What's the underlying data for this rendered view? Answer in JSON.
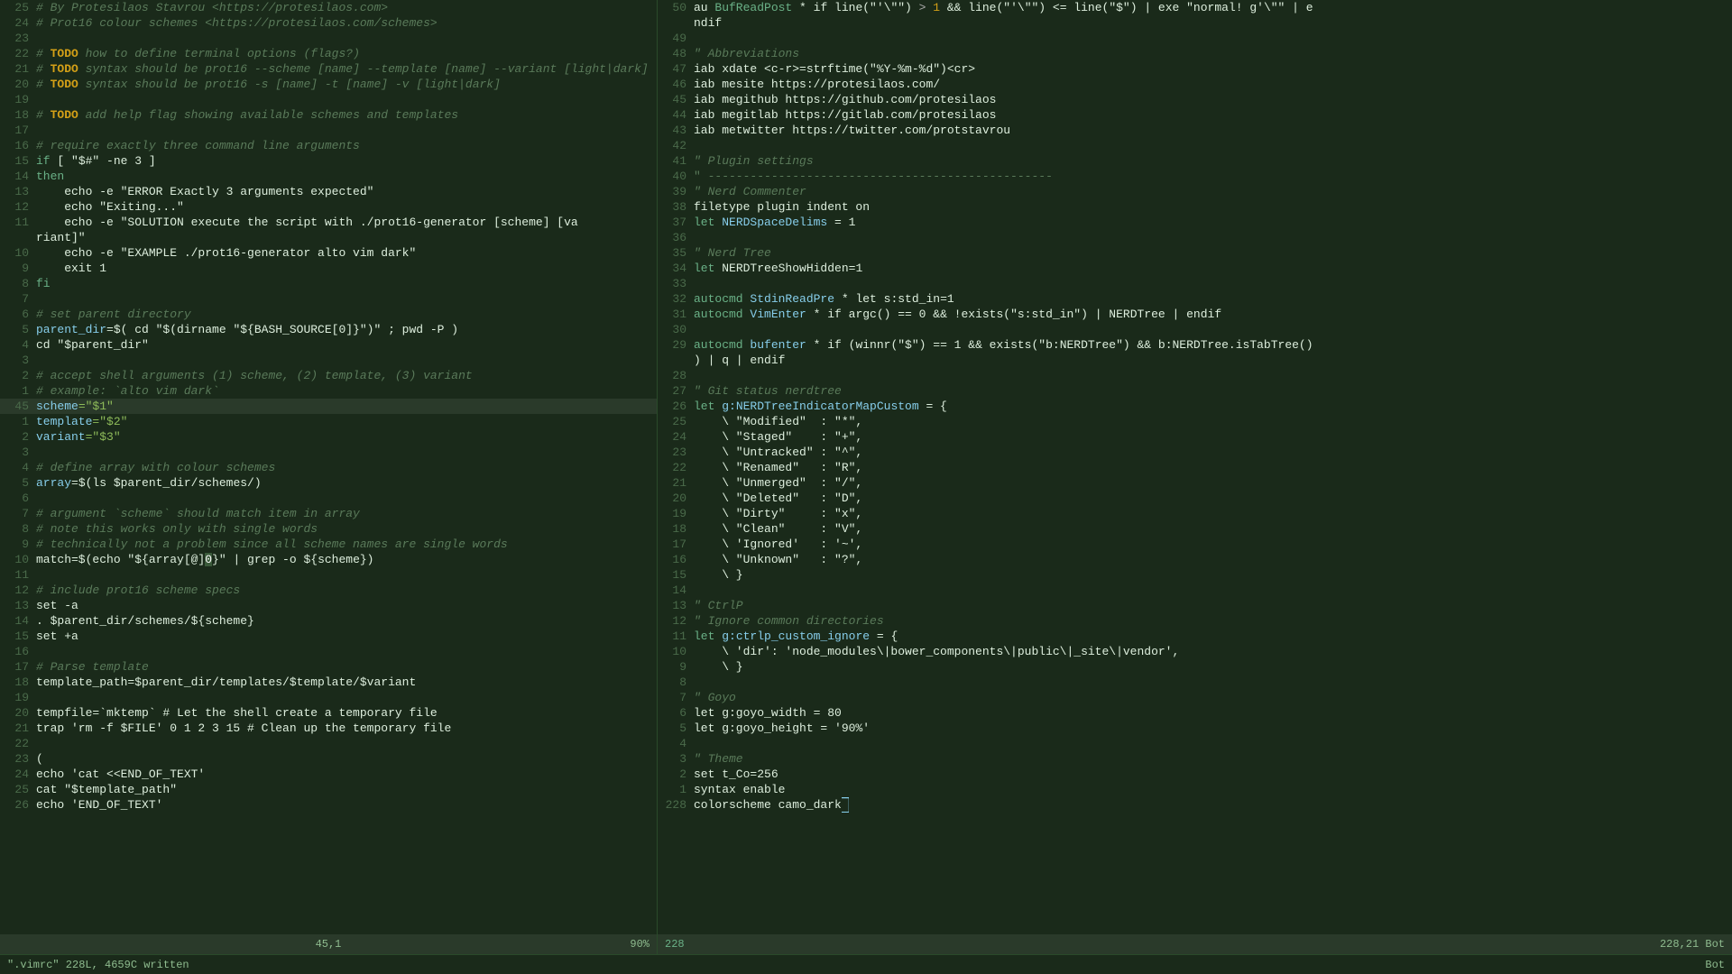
{
  "left_pane": {
    "lines": [
      {
        "num": "25",
        "content": [
          {
            "t": "# By Protesilaos Stavrou <https://protesilaos.com>",
            "c": "c-comment"
          }
        ]
      },
      {
        "num": "24",
        "content": [
          {
            "t": "# Prot16 colour schemes <https://protesilaos.com/schemes>",
            "c": "c-comment"
          }
        ]
      },
      {
        "num": "23",
        "content": []
      },
      {
        "num": "22",
        "content": [
          {
            "t": "# ",
            "c": "c-comment"
          },
          {
            "t": "TODO",
            "c": "c-todo"
          },
          {
            "t": " how to define terminal options (flags?)",
            "c": "c-comment"
          }
        ]
      },
      {
        "num": "21",
        "content": [
          {
            "t": "# ",
            "c": "c-comment"
          },
          {
            "t": "TODO",
            "c": "c-todo"
          },
          {
            "t": " syntax should be prot16 --scheme [name] --template [name] --variant [light|dark]",
            "c": "c-comment"
          }
        ]
      },
      {
        "num": "20",
        "content": [
          {
            "t": "# ",
            "c": "c-comment"
          },
          {
            "t": "TODO",
            "c": "c-todo"
          },
          {
            "t": " syntax should be prot16 -s [name] -t [name] -v [light|dark]",
            "c": "c-comment"
          }
        ]
      },
      {
        "num": "19",
        "content": []
      },
      {
        "num": "18",
        "content": [
          {
            "t": "# ",
            "c": "c-comment"
          },
          {
            "t": "TODO",
            "c": "c-todo"
          },
          {
            "t": " add help flag showing available schemes and templates",
            "c": "c-comment"
          }
        ]
      },
      {
        "num": "17",
        "content": []
      },
      {
        "num": "16",
        "content": [
          {
            "t": "# require exactly three command line arguments",
            "c": "c-comment"
          }
        ]
      },
      {
        "num": "15",
        "content": [
          {
            "t": "if",
            "c": "c-keyword"
          },
          {
            "t": " [ \"$#\" -ne 3 ]",
            "c": "c-white"
          }
        ]
      },
      {
        "num": "14",
        "content": [
          {
            "t": "then",
            "c": "c-keyword"
          }
        ]
      },
      {
        "num": "13",
        "content": [
          {
            "t": "    echo -e \"ERROR Exactly 3 arguments expected\"",
            "c": "c-white"
          }
        ]
      },
      {
        "num": "12",
        "content": [
          {
            "t": "    echo \"Exiting...\"",
            "c": "c-white"
          }
        ]
      },
      {
        "num": "11",
        "content": [
          {
            "t": "    echo -e \"SOLUTION execute the script with ./prot16-generator [scheme] [va",
            "c": "c-white"
          }
        ]
      },
      {
        "num": "",
        "content": [
          {
            "t": "riant]\"",
            "c": "c-white"
          }
        ]
      },
      {
        "num": "10",
        "content": [
          {
            "t": "    echo -e \"EXAMPLE ./prot16-generator alto vim dark\"",
            "c": "c-white"
          }
        ]
      },
      {
        "num": "9",
        "content": [
          {
            "t": "    exit 1",
            "c": "c-white"
          }
        ]
      },
      {
        "num": "8",
        "content": [
          {
            "t": "fi",
            "c": "c-keyword"
          }
        ]
      },
      {
        "num": "7",
        "content": []
      },
      {
        "num": "6",
        "content": [
          {
            "t": "# set parent directory",
            "c": "c-comment"
          }
        ]
      },
      {
        "num": "5",
        "content": [
          {
            "t": "parent_dir",
            "c": "c-var"
          },
          {
            "t": "=$( cd \"$(dirname \"${BASH_SOURCE[0]}\")\" ; pwd -P )",
            "c": "c-white"
          }
        ]
      },
      {
        "num": "4",
        "content": [
          {
            "t": "cd \"$parent_dir\"",
            "c": "c-white"
          }
        ]
      },
      {
        "num": "3",
        "content": []
      },
      {
        "num": "2",
        "content": [
          {
            "t": "# accept shell arguments (1) scheme, (2) template, (3) variant",
            "c": "c-comment"
          }
        ]
      },
      {
        "num": "1",
        "content": [
          {
            "t": "# example: `alto vim dark`",
            "c": "c-comment"
          }
        ]
      },
      {
        "num": "45",
        "highlight": true,
        "content": [
          {
            "t": "scheme",
            "c": "c-var"
          },
          {
            "t": "=\"$1\"",
            "c": "c-string"
          }
        ]
      },
      {
        "num": "1",
        "content": [
          {
            "t": "template",
            "c": "c-var"
          },
          {
            "t": "=\"$2\"",
            "c": "c-string"
          }
        ]
      },
      {
        "num": "2",
        "content": [
          {
            "t": "variant",
            "c": "c-var"
          },
          {
            "t": "=\"$3\"",
            "c": "c-string"
          }
        ]
      },
      {
        "num": "3",
        "content": []
      },
      {
        "num": "4",
        "content": [
          {
            "t": "# define array with colour schemes",
            "c": "c-comment"
          }
        ]
      },
      {
        "num": "5",
        "content": [
          {
            "t": "array",
            "c": "c-var"
          },
          {
            "t": "=$(ls $parent_dir/schemes/)",
            "c": "c-white"
          }
        ]
      },
      {
        "num": "6",
        "content": []
      },
      {
        "num": "7",
        "content": [
          {
            "t": "# argument `scheme` should match item in array",
            "c": "c-comment"
          }
        ]
      },
      {
        "num": "8",
        "content": [
          {
            "t": "# note this works only with single words",
            "c": "c-comment"
          }
        ]
      },
      {
        "num": "9",
        "content": [
          {
            "t": "# technically not a problem since all scheme names are single words",
            "c": "c-comment"
          }
        ]
      },
      {
        "num": "10",
        "content": [
          {
            "t": "match=$(echo \"${array[@]",
            "c": "c-white"
          },
          {
            "t": "0",
            "c": "c-highlight"
          },
          {
            "t": "}\" | grep -o ${scheme})",
            "c": "c-white"
          }
        ]
      },
      {
        "num": "11",
        "content": []
      },
      {
        "num": "12",
        "content": [
          {
            "t": "# include prot16 scheme specs",
            "c": "c-comment"
          }
        ]
      },
      {
        "num": "13",
        "content": [
          {
            "t": "set -a",
            "c": "c-white"
          }
        ]
      },
      {
        "num": "14",
        "content": [
          {
            "t": ". $parent_dir/schemes/${scheme}",
            "c": "c-white"
          }
        ]
      },
      {
        "num": "15",
        "content": [
          {
            "t": "set +a",
            "c": "c-white"
          }
        ]
      },
      {
        "num": "16",
        "content": []
      },
      {
        "num": "17",
        "content": [
          {
            "t": "# Parse template",
            "c": "c-comment"
          }
        ]
      },
      {
        "num": "18",
        "content": [
          {
            "t": "template_path=$parent_dir/templates/$template/$variant",
            "c": "c-white"
          }
        ]
      },
      {
        "num": "19",
        "content": []
      },
      {
        "num": "20",
        "content": [
          {
            "t": "tempfile=`mktemp` # Let the shell create a temporary file",
            "c": "c-white"
          }
        ]
      },
      {
        "num": "21",
        "content": [
          {
            "t": "trap 'rm -f $FILE' 0 1 2 3 15 # Clean up the temporary file",
            "c": "c-white"
          }
        ]
      },
      {
        "num": "22",
        "content": []
      },
      {
        "num": "23",
        "content": [
          {
            "t": "(",
            "c": "c-white"
          }
        ]
      },
      {
        "num": "24",
        "content": [
          {
            "t": "echo 'cat <<END_OF_TEXT'",
            "c": "c-white"
          }
        ]
      },
      {
        "num": "25",
        "content": [
          {
            "t": "cat \"$template_path\"",
            "c": "c-white"
          }
        ]
      },
      {
        "num": "26",
        "content": [
          {
            "t": "echo 'END_OF_TEXT'",
            "c": "c-white"
          }
        ]
      }
    ],
    "status": {
      "left": "",
      "center": "45,1",
      "right": "90%"
    }
  },
  "right_pane": {
    "lines": [
      {
        "num": "50",
        "content": [
          {
            "t": "au ",
            "c": "c-white"
          },
          {
            "t": "BufReadPost",
            "c": "c-keyword"
          },
          {
            "t": " * if line(\"'\\\"\")",
            "c": "c-white"
          },
          {
            "t": " > ",
            "c": "c-operator"
          },
          {
            "t": "1",
            "c": "c-num"
          },
          {
            "t": " && line(\"'\\\"\")",
            "c": "c-white"
          },
          {
            "t": " <= line(\"$\") | exe \"normal! g'\\\"\" | e",
            "c": "c-white"
          }
        ]
      },
      {
        "num": "",
        "content": [
          {
            "t": "ndif",
            "c": "c-white"
          }
        ]
      },
      {
        "num": "49",
        "content": []
      },
      {
        "num": "48",
        "content": [
          {
            "t": "\" Abbreviations",
            "c": "c-comment"
          }
        ]
      },
      {
        "num": "47",
        "content": [
          {
            "t": "iab xdate <c-r>=strftime(\"%Y-%m-%d\")<cr>",
            "c": "c-white"
          }
        ]
      },
      {
        "num": "46",
        "content": [
          {
            "t": "iab mesite https://protesilaos.com/",
            "c": "c-white"
          }
        ]
      },
      {
        "num": "45",
        "content": [
          {
            "t": "iab megithub https://github.com/protesilaos",
            "c": "c-white"
          }
        ]
      },
      {
        "num": "44",
        "content": [
          {
            "t": "iab megitlab https://gitlab.com/protesilaos",
            "c": "c-white"
          }
        ]
      },
      {
        "num": "43",
        "content": [
          {
            "t": "iab metwitter https://twitter.com/protstavrou",
            "c": "c-white"
          }
        ]
      },
      {
        "num": "42",
        "content": []
      },
      {
        "num": "41",
        "content": [
          {
            "t": "\" Plugin settings",
            "c": "c-comment"
          }
        ]
      },
      {
        "num": "40",
        "content": [
          {
            "t": "\" -------------------------------------------------",
            "c": "c-muted"
          }
        ]
      },
      {
        "num": "39",
        "content": [
          {
            "t": "\" Nerd Commenter",
            "c": "c-comment"
          }
        ]
      },
      {
        "num": "38",
        "content": [
          {
            "t": "filetype plugin indent on",
            "c": "c-white"
          }
        ]
      },
      {
        "num": "37",
        "content": [
          {
            "t": "let ",
            "c": "c-keyword"
          },
          {
            "t": "NERDSpaceDelims",
            "c": "c-var"
          },
          {
            "t": " = 1",
            "c": "c-white"
          }
        ]
      },
      {
        "num": "36",
        "content": []
      },
      {
        "num": "35",
        "content": [
          {
            "t": "\" Nerd Tree",
            "c": "c-comment"
          }
        ]
      },
      {
        "num": "34",
        "content": [
          {
            "t": "let ",
            "c": "c-keyword"
          },
          {
            "t": "NERDTreeShowHidden=1",
            "c": "c-white"
          }
        ]
      },
      {
        "num": "33",
        "content": []
      },
      {
        "num": "32",
        "content": [
          {
            "t": "autocmd ",
            "c": "c-keyword"
          },
          {
            "t": "StdinReadPre",
            "c": "c-func"
          },
          {
            "t": " * let s:std_in=1",
            "c": "c-white"
          }
        ]
      },
      {
        "num": "31",
        "content": [
          {
            "t": "autocmd ",
            "c": "c-keyword"
          },
          {
            "t": "VimEnter",
            "c": "c-func"
          },
          {
            "t": " * if argc() == 0 && !exists(\"s:std_in\") | NERDTree | endif",
            "c": "c-white"
          }
        ]
      },
      {
        "num": "30",
        "content": []
      },
      {
        "num": "29",
        "content": [
          {
            "t": "autocmd ",
            "c": "c-keyword"
          },
          {
            "t": "bufenter",
            "c": "c-func"
          },
          {
            "t": " * if (winnr(\"$\") == 1 && exists(\"b:NERDTree\") && b:NERDTree.isTabTree()",
            "c": "c-white"
          }
        ]
      },
      {
        "num": "",
        "content": [
          {
            "t": ") | q | endif",
            "c": "c-white"
          }
        ]
      },
      {
        "num": "28",
        "content": []
      },
      {
        "num": "27",
        "content": [
          {
            "t": "\" Git status nerdtree",
            "c": "c-comment"
          }
        ]
      },
      {
        "num": "26",
        "content": [
          {
            "t": "let ",
            "c": "c-keyword"
          },
          {
            "t": "g:NERDTreeIndicatorMapCustom",
            "c": "c-var"
          },
          {
            "t": " = {",
            "c": "c-white"
          }
        ]
      },
      {
        "num": "25",
        "content": [
          {
            "t": "    \\ \"Modified\"  : \"*\",",
            "c": "c-white"
          }
        ]
      },
      {
        "num": "24",
        "content": [
          {
            "t": "    \\ \"Staged\"    : \"+\",",
            "c": "c-white"
          }
        ]
      },
      {
        "num": "23",
        "content": [
          {
            "t": "    \\ \"Untracked\" : \"^\",",
            "c": "c-white"
          }
        ]
      },
      {
        "num": "22",
        "content": [
          {
            "t": "    \\ \"Renamed\"   : \"R\",",
            "c": "c-white"
          }
        ]
      },
      {
        "num": "21",
        "content": [
          {
            "t": "    \\ \"Unmerged\"  : \"/\",",
            "c": "c-white"
          }
        ]
      },
      {
        "num": "20",
        "content": [
          {
            "t": "    \\ \"Deleted\"   : \"D\",",
            "c": "c-white"
          }
        ]
      },
      {
        "num": "19",
        "content": [
          {
            "t": "    \\ \"Dirty\"     : \"x\",",
            "c": "c-white"
          }
        ]
      },
      {
        "num": "18",
        "content": [
          {
            "t": "    \\ \"Clean\"     : \"V\",",
            "c": "c-white"
          }
        ]
      },
      {
        "num": "17",
        "content": [
          {
            "t": "    \\ 'Ignored'   : '~',",
            "c": "c-white"
          }
        ]
      },
      {
        "num": "16",
        "content": [
          {
            "t": "    \\ \"Unknown\"   : \"?\",",
            "c": "c-white"
          }
        ]
      },
      {
        "num": "15",
        "content": [
          {
            "t": "    \\ }",
            "c": "c-white"
          }
        ]
      },
      {
        "num": "14",
        "content": []
      },
      {
        "num": "13",
        "content": [
          {
            "t": "\" CtrlP",
            "c": "c-comment"
          }
        ]
      },
      {
        "num": "12",
        "content": [
          {
            "t": "\" Ignore common directories",
            "c": "c-comment"
          }
        ]
      },
      {
        "num": "11",
        "content": [
          {
            "t": "let ",
            "c": "c-keyword"
          },
          {
            "t": "g:ctrlp_custom_ignore",
            "c": "c-var"
          },
          {
            "t": " = {",
            "c": "c-white"
          }
        ]
      },
      {
        "num": "10",
        "content": [
          {
            "t": "    \\ 'dir': 'node_modules\\|bower_components\\|public\\|_site\\|vendor',",
            "c": "c-white"
          }
        ]
      },
      {
        "num": "9",
        "content": [
          {
            "t": "    \\ }",
            "c": "c-white"
          }
        ]
      },
      {
        "num": "8",
        "content": []
      },
      {
        "num": "7",
        "content": [
          {
            "t": "\" Goyo",
            "c": "c-comment"
          }
        ]
      },
      {
        "num": "6",
        "content": [
          {
            "t": "let g:goyo_width = 80",
            "c": "c-white"
          }
        ]
      },
      {
        "num": "5",
        "content": [
          {
            "t": "let g:goyo_height = '90%'",
            "c": "c-white"
          }
        ]
      },
      {
        "num": "4",
        "content": []
      },
      {
        "num": "3",
        "content": [
          {
            "t": "\" Theme",
            "c": "c-comment"
          }
        ]
      },
      {
        "num": "2",
        "content": [
          {
            "t": "set t_Co=256",
            "c": "c-white"
          }
        ]
      },
      {
        "num": "1",
        "content": [
          {
            "t": "syntax enable",
            "c": "c-white"
          }
        ]
      },
      {
        "num": "228",
        "highlight": false,
        "content": [
          {
            "t": "colorscheme camo_dark",
            "c": "c-white"
          },
          {
            "t": "█",
            "c": "cursor-block"
          }
        ]
      }
    ],
    "status": {
      "left": "228",
      "center": "",
      "right": "228,21    Bot"
    },
    "file_written": "\".vimrc\" 228L, 4659C written"
  }
}
